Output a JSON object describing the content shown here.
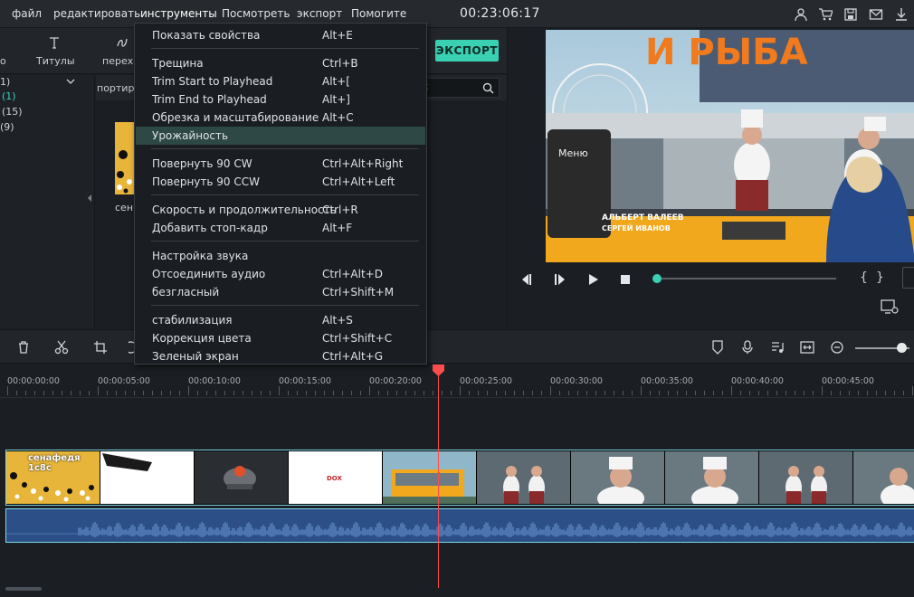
{
  "menubar": {
    "items": [
      "файл",
      "редактировать",
      "инструменты",
      "Посмотреть",
      "экспорт",
      "Помогите"
    ],
    "timecode": "00:23:06:17"
  },
  "toolstrip": {
    "partial_left": "о",
    "titles": "Титулы",
    "transitions_partial": "перехо",
    "export": "ЭКСПОРТ"
  },
  "library": {
    "rows": [
      "1)",
      "(1)",
      "(15)",
      "(9)"
    ]
  },
  "media": {
    "import_partial": "портир",
    "thumb_label": "сен"
  },
  "dropdown": {
    "items": [
      {
        "label": "Показать свойства",
        "shortcut": "Alt+E"
      },
      {
        "label": "Трещина",
        "shortcut": "Ctrl+B"
      },
      {
        "label": "Trim Start to Playhead",
        "shortcut": "Alt+["
      },
      {
        "label": "Trim End to Playhead",
        "shortcut": "Alt+]"
      },
      {
        "label": "Обрезка и масштабирование",
        "shortcut": "Alt+C"
      },
      {
        "label": "Урожайность",
        "shortcut": ""
      },
      {
        "label": "Повернуть 90 CW",
        "shortcut": "Ctrl+Alt+Right"
      },
      {
        "label": "Повернуть 90 CCW",
        "shortcut": "Ctrl+Alt+Left"
      },
      {
        "label": "Скорость и продолжительность",
        "shortcut": "Ctrl+R"
      },
      {
        "label": "Добавить стоп-кадр",
        "shortcut": "Alt+F"
      },
      {
        "label": "Настройка звука",
        "shortcut": ""
      },
      {
        "label": "Отсоединить аудио",
        "shortcut": "Ctrl+Alt+D"
      },
      {
        "label": "безгласный",
        "shortcut": "Ctrl+Shift+M"
      },
      {
        "label": "стабилизация",
        "shortcut": "Alt+S"
      },
      {
        "label": "Коррекция цвета",
        "shortcut": "Ctrl+Shift+C"
      },
      {
        "label": "Зеленый экран",
        "shortcut": "Ctrl+Alt+G"
      }
    ]
  },
  "preview": {
    "bracket_in": "{",
    "bracket_out": "}",
    "video_sign": "И РЫБА",
    "menu_board": "Меню",
    "credits_director": "АЛЬБЕРТ ВАЛЕЕВ",
    "credits_producer": "СЕРГЕЙ ИВАНОВ",
    "playback_progress": 0.02
  },
  "ruler": {
    "labels": [
      "00:00:00:00",
      "00:00:05:00",
      "00:00:10:00",
      "00:00:15:00",
      "00:00:20:00",
      "00:00:25:00",
      "00:00:30:00",
      "00:00:35:00",
      "00:00:40:00",
      "00:00:45:00"
    ]
  },
  "timeline": {
    "first_clip_label": "сенафедя 1с8с",
    "logo_text": "DOX"
  },
  "colors": {
    "accent": "#3ad1b3",
    "playhead": "#ff4c4c",
    "audio": "#2b4f86"
  }
}
